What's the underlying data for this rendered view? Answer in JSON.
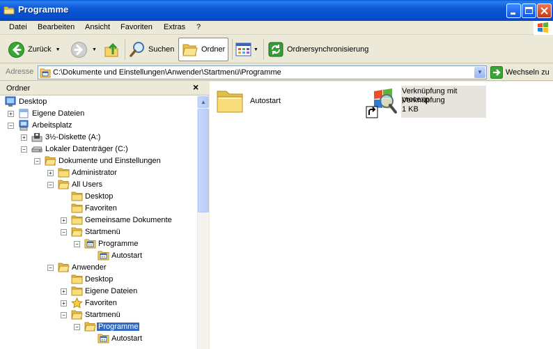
{
  "window": {
    "title": "Programme"
  },
  "menu": [
    "Datei",
    "Bearbeiten",
    "Ansicht",
    "Favoriten",
    "Extras",
    "?"
  ],
  "toolbar": {
    "back_label": "Zurück",
    "search_label": "Suchen",
    "folders_label": "Ordner",
    "sync_label": "Ordnersynchronisierung"
  },
  "address": {
    "label": "Adresse",
    "value": "C:\\Dokumente und Einstellungen\\Anwender\\Startmenü\\Programme",
    "go_label": "Wechseln zu"
  },
  "folder_pane": {
    "title": "Ordner",
    "tree": [
      {
        "label": "Desktop",
        "icon": "desktop-icon",
        "expander": ""
      },
      {
        "label": "Eigene Dateien",
        "icon": "my-documents-icon",
        "expander": "+"
      },
      {
        "label": "Arbeitsplatz",
        "icon": "my-computer-icon",
        "expander": "−"
      },
      {
        "label": "3½-Diskette (A:)",
        "icon": "floppy-drive-icon",
        "expander": "+"
      },
      {
        "label": "Lokaler Datenträger (C:)",
        "icon": "hard-drive-icon",
        "expander": "−"
      },
      {
        "label": "Dokumente und Einstellungen",
        "icon": "folder-open-icon",
        "expander": "−"
      },
      {
        "label": "Administrator",
        "icon": "folder-icon",
        "expander": "+"
      },
      {
        "label": "All Users",
        "icon": "folder-open-icon",
        "expander": "−"
      },
      {
        "label": "Desktop",
        "icon": "folder-icon",
        "expander": ""
      },
      {
        "label": "Favoriten",
        "icon": "folder-icon",
        "expander": ""
      },
      {
        "label": "Gemeinsame Dokumente",
        "icon": "folder-icon",
        "expander": "+"
      },
      {
        "label": "Startmenü",
        "icon": "folder-open-icon",
        "expander": "−"
      },
      {
        "label": "Programme",
        "icon": "programs-folder-icon",
        "expander": "−"
      },
      {
        "label": "Autostart",
        "icon": "programs-folder-icon",
        "expander": ""
      },
      {
        "label": "Anwender",
        "icon": "folder-open-icon",
        "expander": "−"
      },
      {
        "label": "Desktop",
        "icon": "folder-icon",
        "expander": ""
      },
      {
        "label": "Eigene Dateien",
        "icon": "folder-icon",
        "expander": "+"
      },
      {
        "label": "Favoriten",
        "icon": "favorites-star-icon",
        "expander": "+"
      },
      {
        "label": "Startmenü",
        "icon": "folder-open-icon",
        "expander": "−"
      },
      {
        "label": "Programme",
        "icon": "folder-open-icon",
        "expander": "−",
        "selected": true
      },
      {
        "label": "Autostart",
        "icon": "programs-folder-icon",
        "expander": ""
      }
    ]
  },
  "content": {
    "items": [
      {
        "name": "Autostart",
        "icon": "folder-icon"
      },
      {
        "name": "Verknüpfung mit procexp",
        "type": "Verknüpfung",
        "size": "1 KB",
        "icon": "process-explorer-shortcut-icon"
      }
    ]
  },
  "colors": {
    "titlebar": "#0a58d6",
    "selection": "#316ac5",
    "folder": "#f4d46b"
  }
}
